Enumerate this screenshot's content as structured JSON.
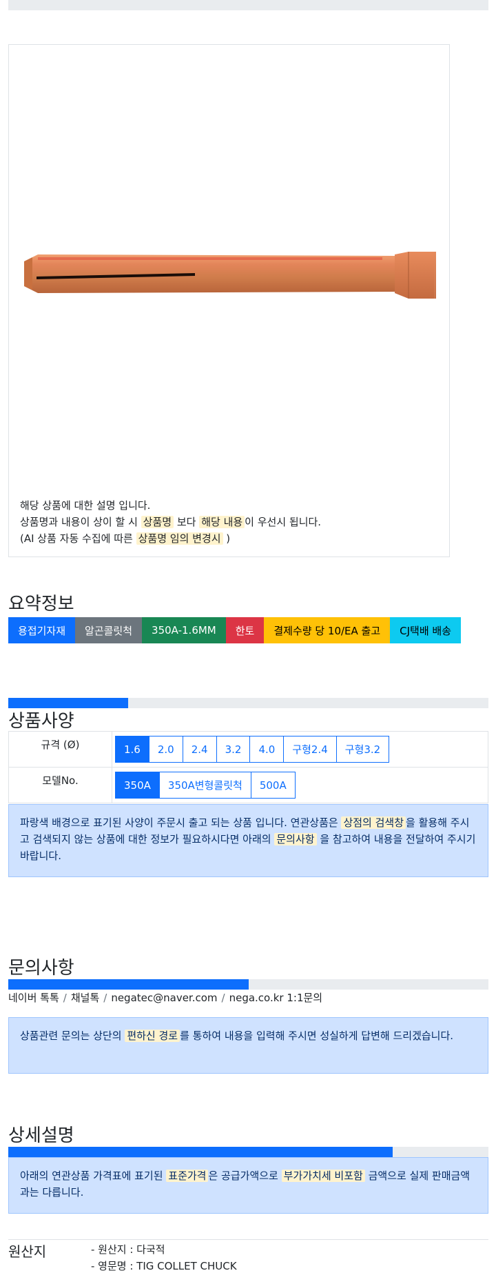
{
  "top_progress": {
    "percent": 0
  },
  "product": {
    "image_icon": "copper-collet-chuck",
    "desc_line1": "해당 상품에 대한 설명 입니다.",
    "desc_line2_a": "상품명과 내용이 상이 할 시 ",
    "desc_line2_hl1": "상품명",
    "desc_line2_b": " 보다 ",
    "desc_line2_hl2": "해당 내용",
    "desc_line2_c": "이 우선시 됩니다.",
    "desc_line3_a": "(AI 상품 자동 수집에 따른 ",
    "desc_line3_hl": "상품명 임의 변경시",
    "desc_line3_b": " )"
  },
  "summary": {
    "title": "요약정보",
    "badges": [
      {
        "label": "용접기자재",
        "bg": "#0d6efd",
        "fg": "#ffffff"
      },
      {
        "label": "알곤콜릿척",
        "bg": "#6c757d",
        "fg": "#ffffff"
      },
      {
        "label": "350A-1.6MM",
        "bg": "#198754",
        "fg": "#ffffff"
      },
      {
        "label": "한토",
        "bg": "#dc3545",
        "fg": "#ffffff"
      },
      {
        "label": "결제수량 당 10/EA 출고",
        "bg": "#ffc107",
        "fg": "#000000"
      },
      {
        "label": "CJ택배 배송",
        "bg": "#0dcaf0",
        "fg": "#000000"
      }
    ]
  },
  "spec": {
    "progress_percent": 25,
    "title": "상품사양",
    "rows": [
      {
        "label": "규격 (Ø)",
        "options": [
          "1.6",
          "2.0",
          "2.4",
          "3.2",
          "4.0",
          "구형2.4",
          "구형3.2"
        ],
        "active": 0
      },
      {
        "label": "모델No.",
        "options": [
          "350A",
          "350A변형콜릿척",
          "500A"
        ],
        "active": 0
      }
    ],
    "note_a": "파랑색 배경으로 표기된 사양이 주문시 출고 되는 상품 입니다. 연관상품은 ",
    "note_hl1": "상점의 검색창",
    "note_b": "을 활용해 주시고 검색되지 않는 상품에 대한 정보가 필요하시다면 아래의 ",
    "note_hl2": "문의사항",
    "note_c": " 을 참고하여 내용을 전달하여 주시기 바랍니다."
  },
  "inquiry": {
    "title": "문의사항",
    "progress_percent": 50,
    "links": [
      "네이버 톡톡",
      "채널톡",
      "negatec@naver.com",
      "nega.co.kr 1:1문의"
    ],
    "separator": "/",
    "note_a": "상품관련 문의는 상단의 ",
    "note_hl": "편하신 경로",
    "note_b": "를 통하여 내용을 입력해 주시면 성실하게 답변해 드리겠습니다."
  },
  "detail": {
    "title": "상세설명",
    "progress_percent": 80,
    "note_a": "아래의 연관상품 가격표에 표기된 ",
    "note_hl1": "표준가격",
    "note_b": "은 공급가액으로 ",
    "note_hl2": "부가가치세 비포함",
    "note_c": " 금액으로 실제 판매금액과는 다릅니다."
  },
  "origin": {
    "label": "원산지",
    "line1": "- 원산지 : 다국적",
    "line2": "- 영문명 : TIG COLLET CHUCK"
  }
}
